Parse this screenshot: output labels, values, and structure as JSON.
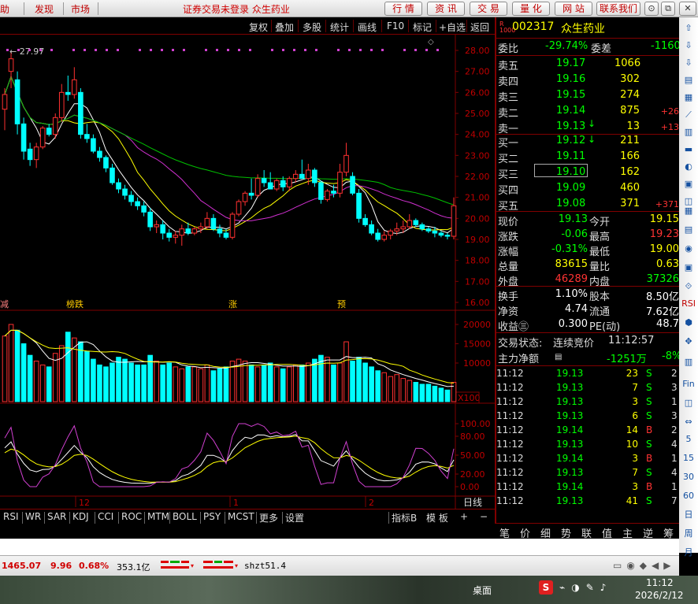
{
  "menubar": {
    "items": [
      "助",
      "发现",
      "市场"
    ],
    "title": "证券交易未登录 众生药业",
    "buttons": [
      "行 情",
      "资 讯",
      "交 易",
      "量 化",
      "网 站",
      "联系我们"
    ],
    "window_buttons": [
      "⊙",
      "_",
      "⧉",
      "✕"
    ]
  },
  "toolbar": {
    "items": [
      "复权",
      "叠加",
      "多股",
      "统计",
      "画线",
      "F10",
      "标记",
      "+自选",
      "返回"
    ]
  },
  "chart": {
    "high_label": "27.97",
    "price_ticks": [
      "28.00",
      "27.00",
      "26.00",
      "25.00",
      "24.00",
      "23.00",
      "22.00",
      "21.00",
      "20.00",
      "19.00",
      "18.00",
      "17.00",
      "16.00"
    ],
    "vol_ticks": [
      "20000",
      "15000",
      "10000"
    ],
    "vol_unit": "X100",
    "ind_ticks": [
      "100.00",
      "80.00",
      "50.00",
      "20.00",
      "0.00"
    ],
    "date_labels": [
      "12",
      "1",
      "2"
    ],
    "period": "日线",
    "event_labels": [
      "减",
      "榜跌",
      "涨",
      "预"
    ],
    "chart_data": {
      "type": "candlestick",
      "candles": [
        {
          "o": 25.2,
          "h": 26.2,
          "l": 24.2,
          "c": 25.9
        },
        {
          "o": 27.0,
          "h": 27.97,
          "l": 26.2,
          "c": 27.6
        },
        {
          "o": 26.6,
          "h": 27.0,
          "l": 24.0,
          "c": 24.5
        },
        {
          "o": 24.5,
          "h": 24.8,
          "l": 22.8,
          "c": 23.2
        },
        {
          "o": 23.3,
          "h": 23.6,
          "l": 22.5,
          "c": 22.8
        },
        {
          "o": 22.8,
          "h": 23.6,
          "l": 22.4,
          "c": 23.4
        },
        {
          "o": 23.4,
          "h": 24.4,
          "l": 23.3,
          "c": 24.3
        },
        {
          "o": 24.3,
          "h": 24.5,
          "l": 23.9,
          "c": 24.0
        },
        {
          "o": 24.0,
          "h": 25.0,
          "l": 23.8,
          "c": 24.8
        },
        {
          "o": 24.8,
          "h": 26.4,
          "l": 24.6,
          "c": 26.0
        },
        {
          "o": 26.0,
          "h": 26.8,
          "l": 25.6,
          "c": 25.9
        },
        {
          "o": 25.9,
          "h": 27.2,
          "l": 25.7,
          "c": 26.6
        },
        {
          "o": 26.0,
          "h": 26.2,
          "l": 23.8,
          "c": 24.0
        },
        {
          "o": 24.0,
          "h": 24.5,
          "l": 23.6,
          "c": 23.8
        },
        {
          "o": 23.8,
          "h": 24.0,
          "l": 23.1,
          "c": 23.2
        },
        {
          "o": 23.2,
          "h": 23.4,
          "l": 22.7,
          "c": 22.9
        },
        {
          "o": 22.9,
          "h": 23.0,
          "l": 22.2,
          "c": 22.4
        },
        {
          "o": 22.4,
          "h": 22.6,
          "l": 21.6,
          "c": 21.7
        },
        {
          "o": 21.7,
          "h": 21.9,
          "l": 21.2,
          "c": 21.4
        },
        {
          "o": 21.4,
          "h": 21.6,
          "l": 20.9,
          "c": 21.1
        },
        {
          "o": 21.1,
          "h": 21.3,
          "l": 20.6,
          "c": 20.8
        },
        {
          "o": 20.8,
          "h": 21.0,
          "l": 20.4,
          "c": 20.6
        },
        {
          "o": 20.6,
          "h": 20.8,
          "l": 20.1,
          "c": 20.3
        },
        {
          "o": 20.3,
          "h": 20.5,
          "l": 19.4,
          "c": 19.6
        },
        {
          "o": 19.6,
          "h": 19.9,
          "l": 19.3,
          "c": 19.7
        },
        {
          "o": 19.7,
          "h": 19.9,
          "l": 19.0,
          "c": 19.3
        },
        {
          "o": 19.3,
          "h": 19.5,
          "l": 18.9,
          "c": 19.1
        },
        {
          "o": 19.1,
          "h": 19.4,
          "l": 18.8,
          "c": 19.2
        },
        {
          "o": 19.2,
          "h": 19.7,
          "l": 18.7,
          "c": 19.5
        },
        {
          "o": 19.5,
          "h": 19.8,
          "l": 19.2,
          "c": 19.3
        },
        {
          "o": 19.3,
          "h": 19.6,
          "l": 19.2,
          "c": 19.5
        },
        {
          "o": 19.5,
          "h": 19.8,
          "l": 19.3,
          "c": 19.6
        },
        {
          "o": 19.6,
          "h": 20.3,
          "l": 19.5,
          "c": 20.0
        },
        {
          "o": 20.0,
          "h": 20.2,
          "l": 19.4,
          "c": 19.5
        },
        {
          "o": 19.5,
          "h": 19.7,
          "l": 19.1,
          "c": 19.3
        },
        {
          "o": 19.3,
          "h": 19.5,
          "l": 19.0,
          "c": 19.1
        },
        {
          "o": 19.1,
          "h": 20.3,
          "l": 19.0,
          "c": 20.2
        },
        {
          "o": 20.2,
          "h": 20.9,
          "l": 20.1,
          "c": 20.8
        },
        {
          "o": 20.8,
          "h": 21.3,
          "l": 20.6,
          "c": 21.2
        },
        {
          "o": 21.2,
          "h": 21.9,
          "l": 20.9,
          "c": 21.1
        },
        {
          "o": 21.1,
          "h": 22.1,
          "l": 21.0,
          "c": 21.9
        },
        {
          "o": 21.9,
          "h": 22.3,
          "l": 21.5,
          "c": 21.7
        },
        {
          "o": 21.7,
          "h": 22.2,
          "l": 21.4,
          "c": 21.4
        },
        {
          "o": 21.4,
          "h": 21.9,
          "l": 21.3,
          "c": 21.8
        },
        {
          "o": 21.8,
          "h": 22.0,
          "l": 21.3,
          "c": 21.5
        },
        {
          "o": 21.5,
          "h": 22.0,
          "l": 21.3,
          "c": 21.9
        },
        {
          "o": 21.9,
          "h": 22.3,
          "l": 21.7,
          "c": 22.1
        },
        {
          "o": 22.1,
          "h": 22.8,
          "l": 21.9,
          "c": 21.9
        },
        {
          "o": 21.9,
          "h": 22.6,
          "l": 21.6,
          "c": 22.3
        },
        {
          "o": 22.3,
          "h": 22.4,
          "l": 21.5,
          "c": 21.7
        },
        {
          "o": 21.7,
          "h": 21.8,
          "l": 20.7,
          "c": 20.9
        },
        {
          "o": 20.9,
          "h": 21.4,
          "l": 20.8,
          "c": 21.3
        },
        {
          "o": 21.3,
          "h": 21.6,
          "l": 21.0,
          "c": 21.2
        },
        {
          "o": 21.2,
          "h": 22.6,
          "l": 21.0,
          "c": 22.2
        },
        {
          "o": 22.2,
          "h": 23.6,
          "l": 22.0,
          "c": 23.0
        },
        {
          "o": 22.0,
          "h": 22.2,
          "l": 21.1,
          "c": 21.2
        },
        {
          "o": 21.2,
          "h": 21.4,
          "l": 19.8,
          "c": 20.0
        },
        {
          "o": 20.0,
          "h": 20.2,
          "l": 19.6,
          "c": 19.7
        },
        {
          "o": 19.7,
          "h": 19.9,
          "l": 19.2,
          "c": 19.3
        },
        {
          "o": 19.3,
          "h": 19.5,
          "l": 18.9,
          "c": 19.0
        },
        {
          "o": 19.0,
          "h": 19.4,
          "l": 18.9,
          "c": 19.2
        },
        {
          "o": 19.2,
          "h": 19.5,
          "l": 19.0,
          "c": 19.4
        },
        {
          "o": 19.4,
          "h": 19.8,
          "l": 19.2,
          "c": 19.5
        },
        {
          "o": 19.5,
          "h": 19.9,
          "l": 19.3,
          "c": 19.6
        },
        {
          "o": 19.6,
          "h": 20.2,
          "l": 19.5,
          "c": 19.9
        },
        {
          "o": 19.9,
          "h": 20.0,
          "l": 19.6,
          "c": 19.7
        },
        {
          "o": 19.7,
          "h": 19.8,
          "l": 19.4,
          "c": 19.5
        },
        {
          "o": 19.5,
          "h": 19.6,
          "l": 19.3,
          "c": 19.4
        },
        {
          "o": 19.4,
          "h": 19.6,
          "l": 19.1,
          "c": 19.3
        },
        {
          "o": 19.3,
          "h": 19.4,
          "l": 19.1,
          "c": 19.2
        },
        {
          "o": 19.2,
          "h": 19.3,
          "l": 19.0,
          "c": 19.15
        },
        {
          "o": 19.15,
          "h": 21.0,
          "l": 19.0,
          "c": 20.6
        }
      ],
      "volumes": [
        17000,
        20000,
        18500,
        15000,
        12000,
        10500,
        9500,
        9000,
        12500,
        14500,
        18000,
        16500,
        15500,
        13000,
        11000,
        9500,
        9000,
        10000,
        11500,
        11000,
        10000,
        9500,
        9500,
        12000,
        10500,
        9500,
        10000,
        9000,
        8500,
        9000,
        9000,
        8500,
        9500,
        8000,
        8500,
        9000,
        10500,
        11000,
        10500,
        9500,
        9000,
        9500,
        10000,
        9000,
        8500,
        9000,
        9500,
        9500,
        10000,
        11000,
        12000,
        11500,
        9500,
        10000,
        15500,
        10500,
        11500,
        10000,
        9000,
        8000,
        7500,
        6500,
        7000,
        6000,
        5500,
        5000,
        4500,
        4500,
        4000,
        3500,
        3000,
        5000
      ],
      "ylim": [
        16.0,
        28.0
      ],
      "vol_ylim": [
        0,
        20000
      ],
      "ind_ylim": [
        0,
        100
      ]
    }
  },
  "bottomtabs": [
    "RSI",
    "WR",
    "SAR",
    "KDJ",
    "CCI",
    "ROC",
    "MTM",
    "BOLL",
    "PSY",
    "MCST",
    "更多",
    "设置",
    "指标B",
    "模 板",
    "+",
    "−"
  ],
  "quote": {
    "code": "002317",
    "name": "众生药业",
    "weibi_label": "委比",
    "weibi": "-29.74%",
    "weicha_label": "委差",
    "weicha": "-1160",
    "sells": [
      {
        "label": "卖五",
        "price": "19.17",
        "vol": "1066",
        "chg": ""
      },
      {
        "label": "卖四",
        "price": "19.16",
        "vol": "302",
        "chg": ""
      },
      {
        "label": "卖三",
        "price": "19.15",
        "vol": "274",
        "chg": ""
      },
      {
        "label": "卖二",
        "price": "19.14",
        "vol": "875",
        "chg": "+26"
      },
      {
        "label": "卖一",
        "price": "19.13",
        "vol": "13",
        "chg": "+13"
      }
    ],
    "buys": [
      {
        "label": "买一",
        "price": "19.12",
        "vol": "211",
        "chg": ""
      },
      {
        "label": "买二",
        "price": "19.11",
        "vol": "166",
        "chg": ""
      },
      {
        "label": "买三",
        "price": "19.10",
        "vol": "162",
        "chg": ""
      },
      {
        "label": "买四",
        "price": "19.09",
        "vol": "460",
        "chg": ""
      },
      {
        "label": "买五",
        "price": "19.08",
        "vol": "371",
        "chg": "+371"
      }
    ],
    "stats": [
      {
        "l1": "现价",
        "v1": "19.13",
        "l2": "今开",
        "v2": "19.15"
      },
      {
        "l1": "涨跌",
        "v1": "-0.06",
        "l2": "最高",
        "v2": "19.23"
      },
      {
        "l1": "涨幅",
        "v1": "-0.31%",
        "l2": "最低",
        "v2": "19.00"
      },
      {
        "l1": "总量",
        "v1": "83615",
        "l2": "量比",
        "v2": "0.63"
      },
      {
        "l1": "外盘",
        "v1": "46289",
        "l2": "内盘",
        "v2": "37326"
      }
    ],
    "stats2": [
      {
        "l1": "换手",
        "v1": "1.10%",
        "l2": "股本",
        "v2": "8.50亿"
      },
      {
        "l1": "净资",
        "v1": "4.74",
        "l2": "流通",
        "v2": "7.62亿"
      },
      {
        "l1": "收益㊂",
        "v1": "0.300",
        "l2": "PE(动)",
        "v2": "48.7"
      }
    ],
    "trade_status_label": "交易状态:",
    "trade_status": "连续竞价",
    "trade_time": "11:12:57",
    "main_flow_label": "主力净额",
    "main_flow": "-1251万",
    "main_flow_pct": "-8%"
  },
  "ticks": [
    {
      "t": "11:12",
      "p": "19.13",
      "v": "23",
      "d": "S",
      "n": "2"
    },
    {
      "t": "11:12",
      "p": "19.13",
      "v": "7",
      "d": "S",
      "n": "3"
    },
    {
      "t": "11:12",
      "p": "19.13",
      "v": "3",
      "d": "S",
      "n": "1"
    },
    {
      "t": "11:12",
      "p": "19.13",
      "v": "6",
      "d": "S",
      "n": "3"
    },
    {
      "t": "11:12",
      "p": "19.14",
      "v": "14",
      "d": "B",
      "n": "2"
    },
    {
      "t": "11:12",
      "p": "19.13",
      "v": "10",
      "d": "S",
      "n": "4"
    },
    {
      "t": "11:12",
      "p": "19.14",
      "v": "3",
      "d": "B",
      "n": "1"
    },
    {
      "t": "11:12",
      "p": "19.13",
      "v": "7",
      "d": "S",
      "n": "4"
    },
    {
      "t": "11:12",
      "p": "19.14",
      "v": "3",
      "d": "B",
      "n": "1"
    },
    {
      "t": "11:12",
      "p": "19.13",
      "v": "41",
      "d": "S",
      "n": "7"
    }
  ],
  "rtabs": [
    "笔",
    "价",
    "细",
    "势",
    "联",
    "值",
    "主",
    "逆",
    "筹"
  ],
  "sidebar_labels": [
    "RSI",
    "Fin",
    "5",
    "15",
    "30",
    "60",
    "日",
    "周",
    "月"
  ],
  "status": {
    "index": "1465.07",
    "change": "9.96",
    "pct": "0.68%",
    "amount": "353.1亿",
    "ticker": "shzt51.4"
  },
  "taskbar": {
    "desktop": "桌面",
    "time": "11:12",
    "date": "2026/2/12"
  }
}
